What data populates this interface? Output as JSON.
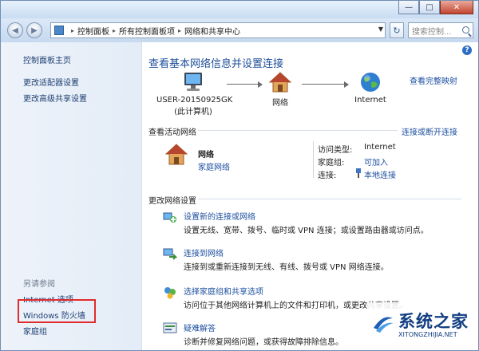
{
  "window": {
    "minimize_glyph": "—",
    "maximize_glyph": "□",
    "close_glyph": "✕"
  },
  "address_bar": {
    "back_glyph": "◀",
    "forward_glyph": "▶",
    "breadcrumbs": [
      "控制面板",
      "所有控制面板项",
      "网络和共享中心"
    ],
    "separator": "▸",
    "refresh_glyph": "↻",
    "search_placeholder": "搜索控制..."
  },
  "sidebar": {
    "top_links": [
      "控制面板主页",
      "更改适配器设置",
      "更改高级共享设置"
    ],
    "see_also_heading": "另请参阅",
    "see_also_links": [
      "Internet 选项",
      "Windows 防火墙",
      "家庭组"
    ]
  },
  "main": {
    "title": "查看基本网络信息并设置连接",
    "view_full_map": "查看完整映射",
    "map_nodes": [
      {
        "label": "USER-20150925GK",
        "sublabel": "(此计算机)",
        "icon": "computer-icon"
      },
      {
        "label": "网络",
        "sublabel": "",
        "icon": "house-icon"
      },
      {
        "label": "Internet",
        "sublabel": "",
        "icon": "globe-icon"
      }
    ],
    "active_networks": {
      "heading": "查看活动网络",
      "connect_link": "连接或断开连接",
      "network_name": "网络",
      "network_type": "家庭网络",
      "access_type_label": "访问类型:",
      "access_type_value": "Internet",
      "homegroup_label": "家庭组:",
      "homegroup_value": "可加入",
      "connection_label": "连接:",
      "connection_value": "本地连接"
    },
    "change_settings": {
      "heading": "更改网络设置",
      "tasks": [
        {
          "icon": "network-setup-icon",
          "title": "设置新的连接或网络",
          "desc": "设置无线、宽带、拨号、临时或 VPN 连接；或设置路由器或访问点。"
        },
        {
          "icon": "connect-network-icon",
          "title": "连接到网络",
          "desc": "连接到或重新连接到无线、有线、拨号或 VPN 网络连接。"
        },
        {
          "icon": "homegroup-icon",
          "title": "选择家庭组和共享选项",
          "desc": "访问位于其他网络计算机上的文件和打印机，或更改共享设置。"
        },
        {
          "icon": "troubleshoot-icon",
          "title": "疑难解答",
          "desc": "诊断并修复网络问题，或获得故障排除信息。"
        }
      ]
    }
  },
  "watermark": {
    "text": "系统之家",
    "sub": "XITONGZHIJIA.NET"
  },
  "colors": {
    "link": "#1e4fa0",
    "title": "#1d4e99",
    "highlight_box": "#e02c2c"
  }
}
